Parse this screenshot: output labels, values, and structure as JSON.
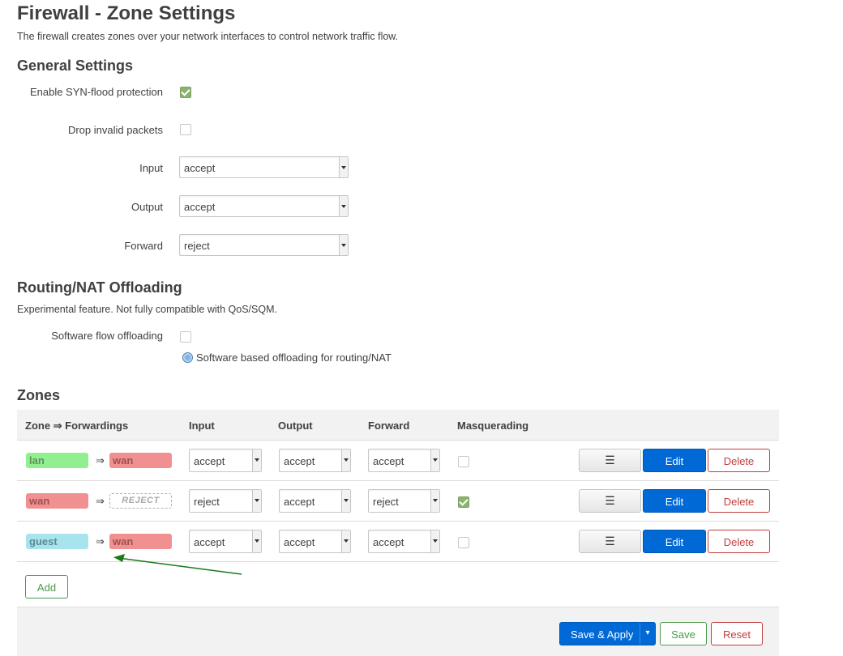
{
  "page": {
    "title": "Firewall - Zone Settings",
    "description": "The firewall creates zones over your network interfaces to control network traffic flow."
  },
  "general": {
    "heading": "General Settings",
    "syn_flood_label": "Enable SYN-flood protection",
    "syn_flood_checked": true,
    "drop_invalid_label": "Drop invalid packets",
    "drop_invalid_checked": false,
    "input_label": "Input",
    "input_value": "accept",
    "output_label": "Output",
    "output_value": "accept",
    "forward_label": "Forward",
    "forward_value": "reject"
  },
  "offload": {
    "heading": "Routing/NAT Offloading",
    "description": "Experimental feature. Not fully compatible with QoS/SQM.",
    "sw_label": "Software flow offloading",
    "sw_checked": false,
    "sw_hint": "Software based offloading for routing/NAT"
  },
  "zones": {
    "heading": "Zones",
    "headers": {
      "zone": "Zone ⇒ Forwardings",
      "input": "Input",
      "output": "Output",
      "forward": "Forward",
      "masq": "Masquerading"
    },
    "arrow": "⇒",
    "rows": [
      {
        "zone": "lan",
        "fwd": "wan",
        "input": "accept",
        "output": "accept",
        "forward": "accept",
        "masq": false
      },
      {
        "zone": "wan",
        "fwd": "REJECT",
        "input": "reject",
        "output": "accept",
        "forward": "reject",
        "masq": true
      },
      {
        "zone": "guest",
        "fwd": "wan",
        "input": "accept",
        "output": "accept",
        "forward": "accept",
        "masq": false
      }
    ],
    "menu_label": "☰",
    "edit_label": "Edit",
    "delete_label": "Delete",
    "add_label": "Add"
  },
  "footer": {
    "save_apply_label": "Save & Apply",
    "dropdown_label": "▾",
    "save_label": "Save",
    "reset_label": "Reset"
  },
  "colors": {
    "primary": "#0069d6",
    "success": "#4a9a4a",
    "danger": "#c43c3c",
    "zone_lan": "#90f090",
    "zone_wan": "#f09090",
    "zone_guest": "#a8e4ee",
    "annotation_arrow": "#1a7a1a"
  }
}
